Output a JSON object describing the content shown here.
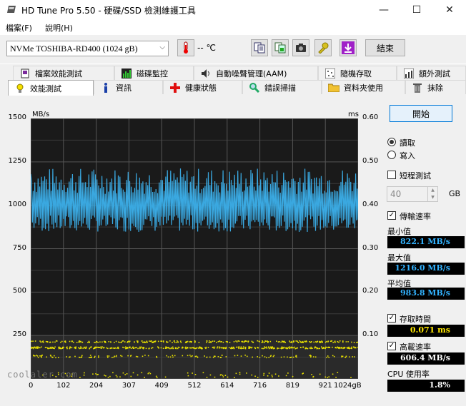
{
  "window": {
    "title": "HD Tune Pro 5.50 - 硬碟/SSD 檢測維護工具",
    "minimize": "—",
    "maximize": "☐",
    "close": "✕"
  },
  "menu": {
    "file": "檔案(F)",
    "help": "說明(H)"
  },
  "toolbar": {
    "drive": "NVMe    TOSHIBA-RD400 (1024 gB)",
    "temperature": "-- ℃",
    "exit_label": "結束"
  },
  "tabs_row1": [
    "檔案效能測試",
    "磁碟監控",
    "自動噪聲管理(AAM)",
    "隨機存取",
    "額外測試"
  ],
  "tabs_row2": [
    "效能測試",
    "資訊",
    "健康狀態",
    "錯誤掃描",
    "資料夾使用",
    "抹除"
  ],
  "panel": {
    "start": "開始",
    "read": "讀取",
    "write": "寫入",
    "short_test": "短程測試",
    "gb_value": "40",
    "gb_unit": "GB",
    "transfer_rate": "傳輸速率",
    "min_label": "最小值",
    "min_value": "822.1 MB/s",
    "max_label": "最大值",
    "max_value": "1216.0 MB/s",
    "avg_label": "平均值",
    "avg_value": "983.8 MB/s",
    "access_time_label": "存取時間",
    "access_time_value": "0.071 ms",
    "burst_label": "高載速率",
    "burst_value": "606.4 MB/s",
    "cpu_label": "CPU 使用率",
    "cpu_value": "1.8%"
  },
  "watermark": "coolaler.com",
  "chart_data": {
    "type": "line",
    "ylabel_left": "MB/s",
    "ylabel_right": "ms",
    "yticks_left": [
      "1500",
      "1250",
      "1000",
      "750",
      "500",
      "250"
    ],
    "yticks_right": [
      "0.60",
      "0.50",
      "0.40",
      "0.30",
      "0.20",
      "0.10"
    ],
    "xticks": [
      "0",
      "102",
      "204",
      "307",
      "409",
      "512",
      "614",
      "716",
      "819",
      "921",
      "1024gB"
    ],
    "ylim_left": [
      0,
      1500
    ],
    "ylim_right": [
      0,
      0.6
    ],
    "xlim": [
      0,
      1024
    ],
    "grid": true,
    "series": [
      {
        "name": "傳輸速率",
        "color": "#3aa8e0",
        "min": 822.1,
        "max": 1216.0,
        "avg": 983.8
      },
      {
        "name": "存取時間",
        "color": "#e8e000",
        "band_ms": [
          0.07,
          0.1
        ]
      }
    ]
  }
}
